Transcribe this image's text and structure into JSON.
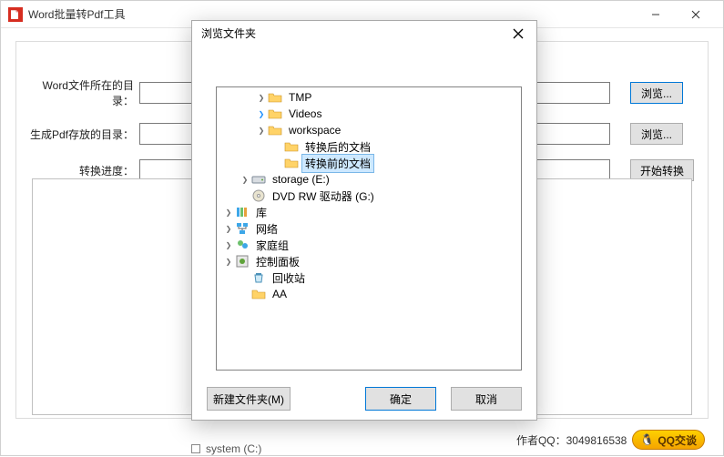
{
  "main": {
    "title": "Word批量转Pdf工具",
    "labels": {
      "src_dir": "Word文件所在的目录：",
      "dst_dir": "生成Pdf存放的目录：",
      "progress": "转换进度："
    },
    "buttons": {
      "browse1": "浏览...",
      "browse2": "浏览...",
      "start": "开始转换"
    },
    "inputs": {
      "src_dir_value": "",
      "dst_dir_value": "",
      "progress_value": ""
    },
    "footer": {
      "author": "作者QQ：3049816538",
      "qq_badge": "QQ交谈"
    }
  },
  "dialog": {
    "title": "浏览文件夹",
    "buttons": {
      "new_folder": "新建文件夹(M)",
      "ok": "确定",
      "cancel": "取消"
    },
    "tree": [
      {
        "depth": 2,
        "twisty": ">",
        "icon": "folder-icon",
        "label": "TMP"
      },
      {
        "depth": 2,
        "twisty": ">",
        "twisty_class": "blue",
        "icon": "folder-icon",
        "label": "Videos"
      },
      {
        "depth": 2,
        "twisty": ">",
        "icon": "folder-icon",
        "label": "workspace"
      },
      {
        "depth": 3,
        "twisty": "",
        "icon": "folder-icon",
        "label": "转换后的文档"
      },
      {
        "depth": 3,
        "twisty": "",
        "icon": "folder-icon",
        "label": "转换前的文档",
        "selected": true
      },
      {
        "depth": 1,
        "twisty": ">",
        "icon": "drive-icon",
        "label": "storage (E:)"
      },
      {
        "depth": 1,
        "twisty": "",
        "icon": "disc-icon",
        "label": "DVD RW 驱动器 (G:)"
      },
      {
        "depth": 0,
        "twisty": ">",
        "icon": "library-icon",
        "label": "库"
      },
      {
        "depth": 0,
        "twisty": ">",
        "icon": "network-icon",
        "label": "网络"
      },
      {
        "depth": 0,
        "twisty": ">",
        "icon": "homegroup-icon",
        "label": "家庭组"
      },
      {
        "depth": 0,
        "twisty": ">",
        "icon": "control-panel-icon",
        "label": "控制面板"
      },
      {
        "depth": 1,
        "twisty": "",
        "icon": "recycle-bin-icon",
        "label": "回收站"
      },
      {
        "depth": 1,
        "twisty": "",
        "icon": "folder-icon",
        "label": "AA"
      }
    ]
  },
  "stray": {
    "label": "system (C:)"
  },
  "icons": {
    "folder": "📁",
    "drive": "🖴",
    "disc": "💿",
    "library": "📚",
    "network": "🖧",
    "homegroup": "👪",
    "control": "🛠",
    "recycle": "🗑",
    "penguin": "🐧"
  }
}
